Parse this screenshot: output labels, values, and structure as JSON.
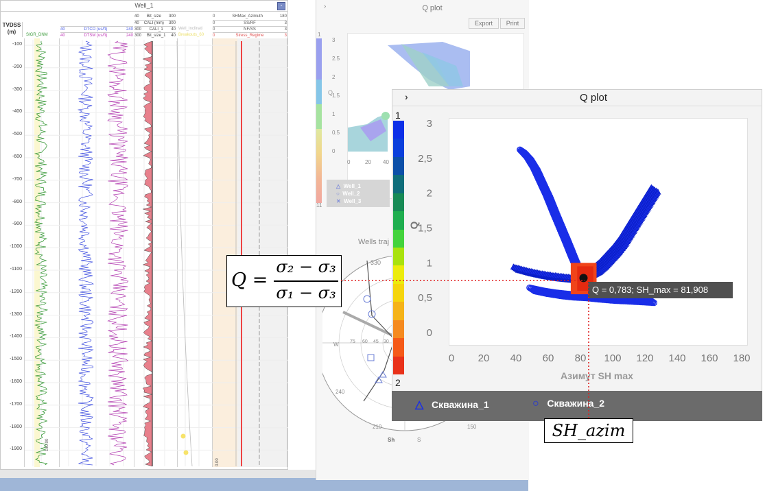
{
  "well_panel": {
    "title": "Well_1",
    "depth_header": {
      "line1": "TVDSS",
      "line2": "(m)"
    },
    "headers": {
      "bit_size": {
        "min": "40",
        "name": "Bit_size",
        "max": "300"
      },
      "cali_mm": {
        "min": "40",
        "name": "CALI (mm)",
        "max": "300"
      },
      "cali_1": {
        "min": "300",
        "name": "CALI_1",
        "max": "40"
      },
      "bit_size_1": {
        "min": "300",
        "name": "Bit_size_1",
        "max": "40"
      },
      "dtco": {
        "min": "40",
        "name": "DTCO (us/ft)",
        "max": "240"
      },
      "dtsm": {
        "min": "40",
        "name": "DTSM (us/ft)",
        "max": "240"
      },
      "sgr": {
        "name": "SIGR_DNM"
      },
      "shmax_azimuth": {
        "min": "0",
        "name": "SHMax_Azimuth",
        "max": "180"
      },
      "ss_rf": {
        "min": "0",
        "name": "SS/RF",
        "max": "3"
      },
      "nf_ss": {
        "min": "0",
        "name": "NF/SS",
        "max": "3"
      },
      "stress_regime": {
        "min": "0",
        "name": "Stress_Regime",
        "max": "3"
      },
      "well_inclination": {
        "name": "Well_Inclinati"
      },
      "breakouts": {
        "name": "Breakouts_60"
      }
    },
    "depth_ticks": [
      "-100",
      "-200",
      "-300",
      "-400",
      "-500",
      "-600",
      "-700",
      "-800",
      "-900",
      "-1000",
      "-1100",
      "-1200",
      "-1300",
      "-1400",
      "-1500",
      "-1600",
      "-1700",
      "-1800",
      "-1900"
    ],
    "footer_labels": {
      "gr_max": "150.00",
      "track_min": "0.00"
    }
  },
  "back_qplot": {
    "title": "Q plot",
    "export_label": "Export",
    "print_label": "Print",
    "colorbar_top": "1",
    "colorbar_bottom": "11",
    "y_ticks": [
      "3",
      "2.5",
      "2",
      "1.5",
      "1",
      "0.5",
      "0"
    ],
    "x_ticks": [
      "0",
      "20",
      "40"
    ],
    "ylabel": "Q",
    "legend": [
      "Well_1",
      "Well_2",
      "Well_3"
    ],
    "stereonet_title": "Wells traj",
    "stereonet_labels": {
      "deg330": "330",
      "deg240": "240",
      "deg210": "210",
      "deg150": "150",
      "w": "W",
      "s": "S",
      "sh": "Sh",
      "r75": "75",
      "r60": "60",
      "r45": "45",
      "r30": "30"
    }
  },
  "front_qplot": {
    "title": "Q plot",
    "collapse_glyph": "›",
    "colorbar_top": "1",
    "colorbar_bottom": "2",
    "tooltip": "Q = 0,783; SH_max = 81,908",
    "legend": [
      {
        "marker": "triangle",
        "label": "Скважина_1"
      },
      {
        "marker": "circle",
        "label": "Скважина_2"
      }
    ]
  },
  "formula": {
    "q": "Q =",
    "numerator": "σ₂ − σ₃",
    "denominator": "σ₁ − σ₃"
  },
  "callout_label": "SH_azim",
  "chart_data": {
    "type": "scatter",
    "title": "Q plot",
    "xlabel": "Азимут SH max",
    "ylabel": "Q",
    "xlim": [
      0,
      180
    ],
    "ylim": [
      0,
      3
    ],
    "x_ticks": [
      "0",
      "20",
      "40",
      "60",
      "80",
      "100",
      "120",
      "140",
      "160",
      "180"
    ],
    "y_ticks": [
      "0",
      "0,5",
      "1",
      "1,5",
      "2",
      "2,5",
      "3"
    ],
    "series": [
      {
        "name": "Скважина_1",
        "marker": "triangle",
        "x": [
          126,
          122,
          118,
          114,
          110,
          106,
          102,
          98,
          94,
          90,
          86,
          82,
          40,
          48,
          56,
          64,
          72,
          80
        ],
        "y": [
          2.05,
          1.9,
          1.75,
          1.6,
          1.45,
          1.3,
          1.18,
          1.08,
          0.98,
          0.9,
          0.85,
          0.8,
          0.92,
          0.87,
          0.83,
          0.8,
          0.78,
          0.76
        ]
      },
      {
        "name": "Скважина_2",
        "marker": "circle",
        "x": [
          44,
          48,
          52,
          56,
          60,
          64,
          68,
          72,
          76,
          80,
          50,
          58,
          66,
          74,
          82,
          90,
          100,
          110,
          118,
          125
        ],
        "y": [
          2.6,
          2.5,
          2.35,
          2.15,
          1.95,
          1.72,
          1.5,
          1.28,
          1.05,
          0.85,
          0.62,
          0.58,
          0.55,
          0.53,
          0.52,
          0.5,
          0.48,
          0.47,
          0.46,
          0.45
        ]
      }
    ],
    "highlight": {
      "x": 81.908,
      "y": 0.783
    },
    "colorbar_colors": [
      "#e9321a",
      "#f55a18",
      "#f58a1f",
      "#f5b318",
      "#f5d50d",
      "#ecec0c",
      "#a9e20e",
      "#43d33c",
      "#1fae4f",
      "#178a55",
      "#0f6d7a",
      "#0c4fa8",
      "#0a3fdc",
      "#0c2fe8"
    ]
  }
}
